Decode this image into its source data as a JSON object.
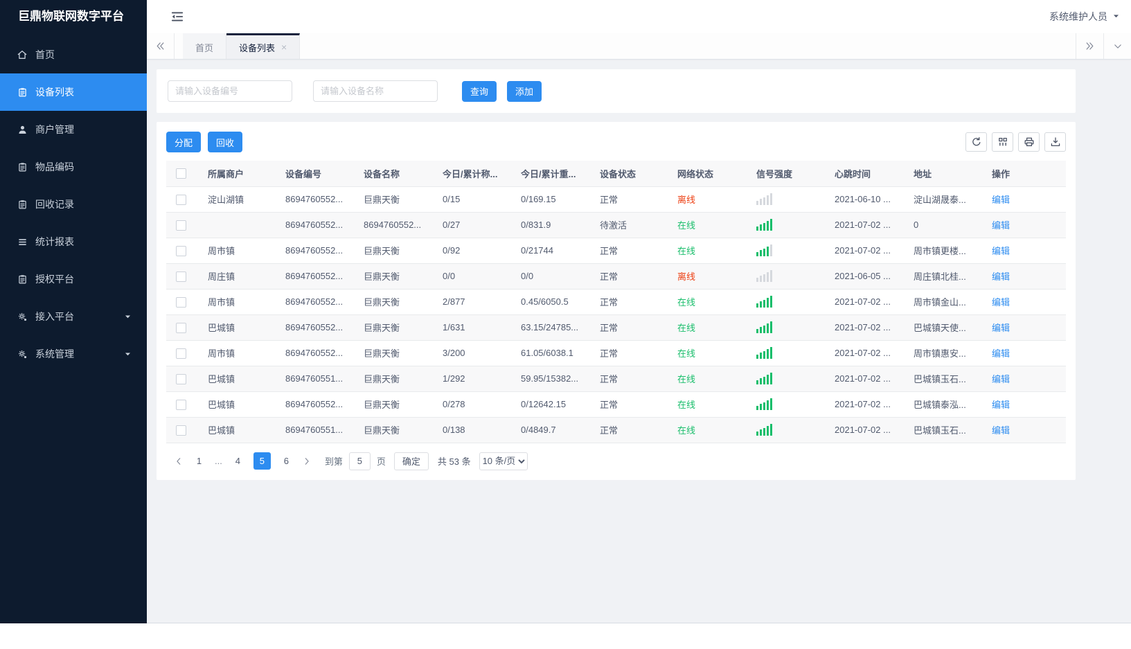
{
  "app": {
    "title": "巨鼎物联网数字平台",
    "user": "系统维护人员"
  },
  "colors": {
    "accent": "#2d8cf0",
    "sidebar_bg": "#0d1b2e",
    "online": "#19be6b",
    "offline": "#ed4014"
  },
  "sidebar": {
    "items": [
      {
        "key": "home",
        "label": "首页",
        "icon": "home-icon",
        "active": false,
        "expandable": false
      },
      {
        "key": "device-list",
        "label": "设备列表",
        "icon": "clipboard-icon",
        "active": true,
        "expandable": false
      },
      {
        "key": "merchant-mgmt",
        "label": "商户管理",
        "icon": "user-icon",
        "active": false,
        "expandable": false
      },
      {
        "key": "item-code",
        "label": "物品编码",
        "icon": "clipboard-icon",
        "active": false,
        "expandable": false
      },
      {
        "key": "recycle-records",
        "label": "回收记录",
        "icon": "clipboard-icon",
        "active": false,
        "expandable": false
      },
      {
        "key": "stats-report",
        "label": "统计报表",
        "icon": "list-icon",
        "active": false,
        "expandable": false
      },
      {
        "key": "auth-platform",
        "label": "授权平台",
        "icon": "clipboard-icon",
        "active": false,
        "expandable": false
      },
      {
        "key": "access-platform",
        "label": "接入平台",
        "icon": "gear-icon",
        "active": false,
        "expandable": true
      },
      {
        "key": "system-mgmt",
        "label": "系统管理",
        "icon": "gear-icon",
        "active": false,
        "expandable": true
      }
    ]
  },
  "tabs": [
    {
      "key": "home",
      "label": "首页",
      "active": false,
      "closable": false
    },
    {
      "key": "device-list",
      "label": "设备列表",
      "active": true,
      "closable": true
    }
  ],
  "search": {
    "device_no_placeholder": "请输入设备编号",
    "device_name_placeholder": "请输入设备名称",
    "query_label": "查询",
    "add_label": "添加"
  },
  "toolbar": {
    "assign_label": "分配",
    "recycle_label": "回收"
  },
  "table": {
    "headers": [
      "所属商户",
      "设备编号",
      "设备名称",
      "今日/累计称...",
      "今日/累计重...",
      "设备状态",
      "网络状态",
      "信号强度",
      "心跳时间",
      "地址",
      "操作"
    ],
    "edit_label": "编辑",
    "rows": [
      {
        "merchant": "淀山湖镇",
        "device_no": "8694760552...",
        "device_name": "巨鼎天衡",
        "count": "0/15",
        "weight": "0/169.15",
        "status": "正常",
        "network": "离线",
        "online": false,
        "signal": 0,
        "heartbeat": "2021-06-10 ...",
        "address": "淀山湖晟泰..."
      },
      {
        "merchant": "",
        "device_no": "8694760552...",
        "device_name": "8694760552...",
        "count": "0/27",
        "weight": "0/831.9",
        "status": "待激活",
        "network": "在线",
        "online": true,
        "signal": 5,
        "heartbeat": "2021-07-02 ...",
        "address": "0"
      },
      {
        "merchant": "周市镇",
        "device_no": "8694760552...",
        "device_name": "巨鼎天衡",
        "count": "0/92",
        "weight": "0/21744",
        "status": "正常",
        "network": "在线",
        "online": true,
        "signal": 4,
        "heartbeat": "2021-07-02 ...",
        "address": "周市镇更楼..."
      },
      {
        "merchant": "周庄镇",
        "device_no": "8694760552...",
        "device_name": "巨鼎天衡",
        "count": "0/0",
        "weight": "0/0",
        "status": "正常",
        "network": "离线",
        "online": false,
        "signal": 0,
        "heartbeat": "2021-06-05 ...",
        "address": "周庄镇北桂..."
      },
      {
        "merchant": "周市镇",
        "device_no": "8694760552...",
        "device_name": "巨鼎天衡",
        "count": "2/877",
        "weight": "0.45/6050.5",
        "status": "正常",
        "network": "在线",
        "online": true,
        "signal": 5,
        "heartbeat": "2021-07-02 ...",
        "address": "周市镇金山..."
      },
      {
        "merchant": "巴城镇",
        "device_no": "8694760552...",
        "device_name": "巨鼎天衡",
        "count": "1/631",
        "weight": "63.15/24785...",
        "status": "正常",
        "network": "在线",
        "online": true,
        "signal": 5,
        "heartbeat": "2021-07-02 ...",
        "address": "巴城镇天使..."
      },
      {
        "merchant": "周市镇",
        "device_no": "8694760552...",
        "device_name": "巨鼎天衡",
        "count": "3/200",
        "weight": "61.05/6038.1",
        "status": "正常",
        "network": "在线",
        "online": true,
        "signal": 5,
        "heartbeat": "2021-07-02 ...",
        "address": "周市镇惠安..."
      },
      {
        "merchant": "巴城镇",
        "device_no": "8694760551...",
        "device_name": "巨鼎天衡",
        "count": "1/292",
        "weight": "59.95/15382...",
        "status": "正常",
        "network": "在线",
        "online": true,
        "signal": 5,
        "heartbeat": "2021-07-02 ...",
        "address": "巴城镇玉石..."
      },
      {
        "merchant": "巴城镇",
        "device_no": "8694760552...",
        "device_name": "巨鼎天衡",
        "count": "0/278",
        "weight": "0/12642.15",
        "status": "正常",
        "network": "在线",
        "online": true,
        "signal": 5,
        "heartbeat": "2021-07-02 ...",
        "address": "巴城镇泰泓..."
      },
      {
        "merchant": "巴城镇",
        "device_no": "8694760551...",
        "device_name": "巨鼎天衡",
        "count": "0/138",
        "weight": "0/4849.7",
        "status": "正常",
        "network": "在线",
        "online": true,
        "signal": 5,
        "heartbeat": "2021-07-02 ...",
        "address": "巴城镇玉石..."
      }
    ]
  },
  "pagination": {
    "pages": [
      "1",
      "...",
      "4",
      "5",
      "6"
    ],
    "active": "5",
    "goto_label": "到第",
    "goto_value": "5",
    "page_label": "页",
    "confirm_label": "确定",
    "total_label": "共 53 条",
    "page_size": "10 条/页"
  },
  "icons": {
    "tab_close": "×",
    "ellipsis": "..."
  }
}
